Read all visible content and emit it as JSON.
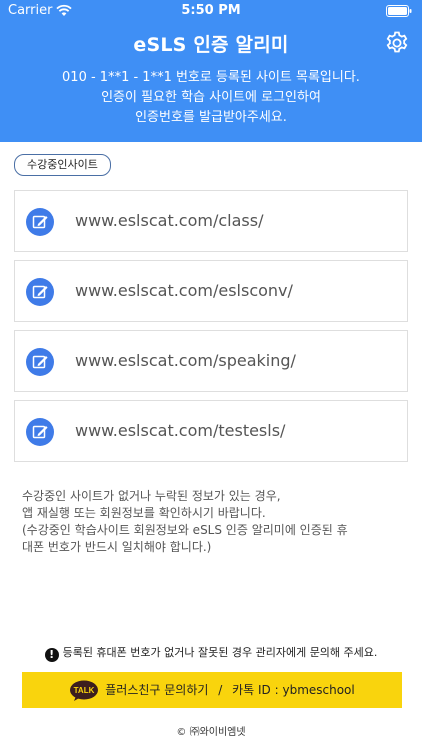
{
  "status_bar": {
    "carrier": "Carrier",
    "time": "5:50 PM",
    "wifi_icon": "wifi-icon",
    "battery_icon": "battery-icon"
  },
  "header": {
    "title": "eSLS 인증 알리미",
    "settings_icon": "gear-icon",
    "description_lines": [
      "010 - 1**1 - 1**1 번호로 등록된 사이트 목록입니다.",
      "인증이 필요한 학습 사이트에 로그인하여",
      "인증번호를 발급받아주세요."
    ],
    "background_color": "#3f8ff5"
  },
  "tag_label": "수강중인사이트",
  "sites": [
    {
      "url": "www.eslscat.com/class/",
      "icon": "edit-icon"
    },
    {
      "url": "www.eslscat.com/eslsconv/",
      "icon": "edit-icon"
    },
    {
      "url": "www.eslscat.com/speaking/",
      "icon": "edit-icon"
    },
    {
      "url": "www.eslscat.com/testesls/",
      "icon": "edit-icon"
    }
  ],
  "notice_lines": [
    "수강중인 사이트가 없거나 누락된 정보가 있는 경우,",
    "앱 재실행 또는 회원정보를 확인하시기 바랍니다.",
    "(수강중인 학습사이트 회원정보와 eSLS 인증 알리미에 인증된 휴",
    "대폰 번호가 반드시 일치해야 합니다.)"
  ],
  "warning": {
    "icon_glyph": "!",
    "text": "등록된 휴대폰 번호가 없거나 잘못된 경우 관리자에게 문의해 주세요."
  },
  "kakao": {
    "talk_badge": "TALK",
    "label": "플러스친구 문의하기",
    "separator": "/",
    "account": "카톡 ID : ybmeschool",
    "color": "#f9d40d"
  },
  "copyright": "© ㈜와이비엠넷"
}
